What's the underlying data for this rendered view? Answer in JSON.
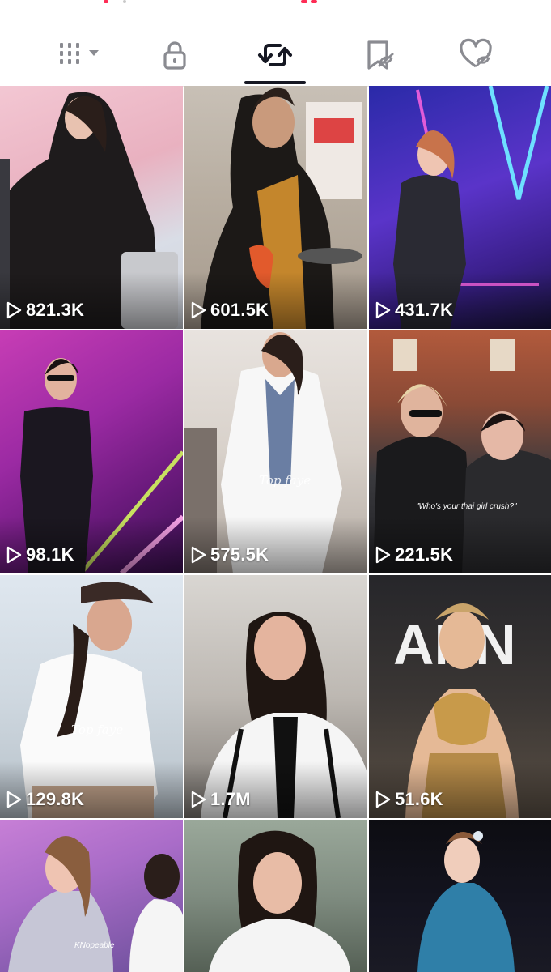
{
  "tabs": [
    {
      "name": "grid-menu-icon",
      "active": false
    },
    {
      "name": "lock-icon",
      "active": false
    },
    {
      "name": "repost-icon",
      "active": true
    },
    {
      "name": "bookmark-icon",
      "active": false
    },
    {
      "name": "liked-heart-icon",
      "active": false
    }
  ],
  "colors": {
    "text": "#161823",
    "icon": "#8a8b91",
    "active_icon": "#161823",
    "top_accent": "#fe2c55",
    "white": "#ffffff"
  },
  "videos": [
    {
      "views": "821.3K",
      "icon": "play-icon"
    },
    {
      "views": "601.5K",
      "icon": "play-icon"
    },
    {
      "views": "431.7K",
      "icon": "play-icon"
    },
    {
      "views": "98.1K",
      "icon": "play-icon"
    },
    {
      "views": "575.5K",
      "icon": "play-icon"
    },
    {
      "views": "221.5K",
      "icon": "play-icon"
    },
    {
      "views": "129.8K",
      "icon": "play-icon"
    },
    {
      "views": "1.7M",
      "icon": "play-icon"
    },
    {
      "views": "51.6K",
      "icon": "play-icon"
    },
    {
      "views": "",
      "icon": ""
    },
    {
      "views": "",
      "icon": ""
    },
    {
      "views": "",
      "icon": ""
    }
  ],
  "overlays": {
    "watermark_1": "Top faye",
    "watermark_2": "Top faye",
    "caption_1": "\"Who's your thai girl crush?\"",
    "caption_2": "KNopeable",
    "sign_letters": "ANN"
  }
}
